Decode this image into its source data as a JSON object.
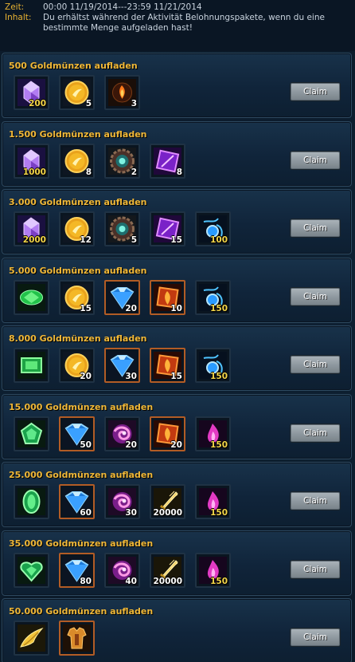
{
  "header": {
    "time_label": "Zeit:",
    "time_value": "00:00 11/19/2014---23:59 11/21/2014",
    "content_label": "Inhalt:",
    "content_value": "Du erhältst während der Aktivität Belohnungspakete, wenn du eine bestimmte Menge aufgeladen hast!"
  },
  "claim_label": "Claim",
  "tiers": [
    {
      "title": "500 Goldmünzen aufladen",
      "items": [
        {
          "icon": "purple-crystal-icon",
          "qty": "200",
          "gold": true
        },
        {
          "icon": "gold-coin-icon",
          "qty": "5"
        },
        {
          "icon": "fire-orb-icon",
          "qty": "3"
        }
      ]
    },
    {
      "title": "1.500 Goldmünzen aufladen",
      "items": [
        {
          "icon": "purple-crystal-icon",
          "qty": "1000",
          "gold": true
        },
        {
          "icon": "gold-coin-icon",
          "qty": "8"
        },
        {
          "icon": "gear-gem-icon",
          "qty": "2"
        },
        {
          "icon": "purple-scroll-icon",
          "qty": "8"
        }
      ]
    },
    {
      "title": "3.000 Goldmünzen aufladen",
      "items": [
        {
          "icon": "purple-crystal-icon",
          "qty": "2000",
          "gold": true
        },
        {
          "icon": "gold-coin-icon",
          "qty": "12"
        },
        {
          "icon": "gear-gem-icon",
          "qty": "5"
        },
        {
          "icon": "purple-scroll-icon",
          "qty": "15"
        },
        {
          "icon": "blue-spirit-orb-icon",
          "qty": "100",
          "gold": true
        }
      ]
    },
    {
      "title": "5.000 Goldmünzen aufladen",
      "items": [
        {
          "icon": "green-gem-icon",
          "qty": ""
        },
        {
          "icon": "gold-coin-icon",
          "qty": "15"
        },
        {
          "icon": "blue-diamond-icon",
          "qty": "20",
          "framed": true
        },
        {
          "icon": "fire-scroll-icon",
          "qty": "10",
          "framed": true
        },
        {
          "icon": "blue-spirit-orb-icon",
          "qty": "150",
          "gold": true
        }
      ]
    },
    {
      "title": "8.000 Goldmünzen aufladen",
      "items": [
        {
          "icon": "green-emerald-icon",
          "qty": ""
        },
        {
          "icon": "gold-coin-icon",
          "qty": "20"
        },
        {
          "icon": "blue-diamond-icon",
          "qty": "30",
          "framed": true
        },
        {
          "icon": "fire-scroll-icon",
          "qty": "15",
          "framed": true
        },
        {
          "icon": "blue-spirit-orb-icon",
          "qty": "150",
          "gold": true
        }
      ]
    },
    {
      "title": "15.000 Goldmünzen aufladen",
      "items": [
        {
          "icon": "green-pentagon-gem-icon",
          "qty": ""
        },
        {
          "icon": "blue-diamond-icon",
          "qty": "50",
          "framed": true
        },
        {
          "icon": "pink-swirl-orb-icon",
          "qty": "20"
        },
        {
          "icon": "fire-scroll-icon",
          "qty": "20",
          "framed": true
        },
        {
          "icon": "pink-flame-icon",
          "qty": "150",
          "gold": true
        }
      ]
    },
    {
      "title": "25.000 Goldmünzen aufladen",
      "items": [
        {
          "icon": "green-oval-gem-icon",
          "qty": ""
        },
        {
          "icon": "blue-diamond-icon",
          "qty": "60",
          "framed": true
        },
        {
          "icon": "pink-swirl-orb-icon",
          "qty": "30"
        },
        {
          "icon": "golden-sword-icon",
          "qty": "20000"
        },
        {
          "icon": "pink-flame-icon",
          "qty": "150",
          "gold": true
        }
      ]
    },
    {
      "title": "35.000 Goldmünzen aufladen",
      "items": [
        {
          "icon": "green-heart-gem-icon",
          "qty": ""
        },
        {
          "icon": "blue-diamond-icon",
          "qty": "80",
          "framed": true
        },
        {
          "icon": "pink-swirl-orb-icon",
          "qty": "40"
        },
        {
          "icon": "golden-sword-icon",
          "qty": "20000"
        },
        {
          "icon": "pink-flame-icon",
          "qty": "150",
          "gold": true
        }
      ]
    },
    {
      "title": "50.000 Goldmünzen aufladen",
      "items": [
        {
          "icon": "golden-wings-icon",
          "qty": ""
        },
        {
          "icon": "golden-armor-icon",
          "qty": "",
          "framed": true
        }
      ]
    }
  ]
}
